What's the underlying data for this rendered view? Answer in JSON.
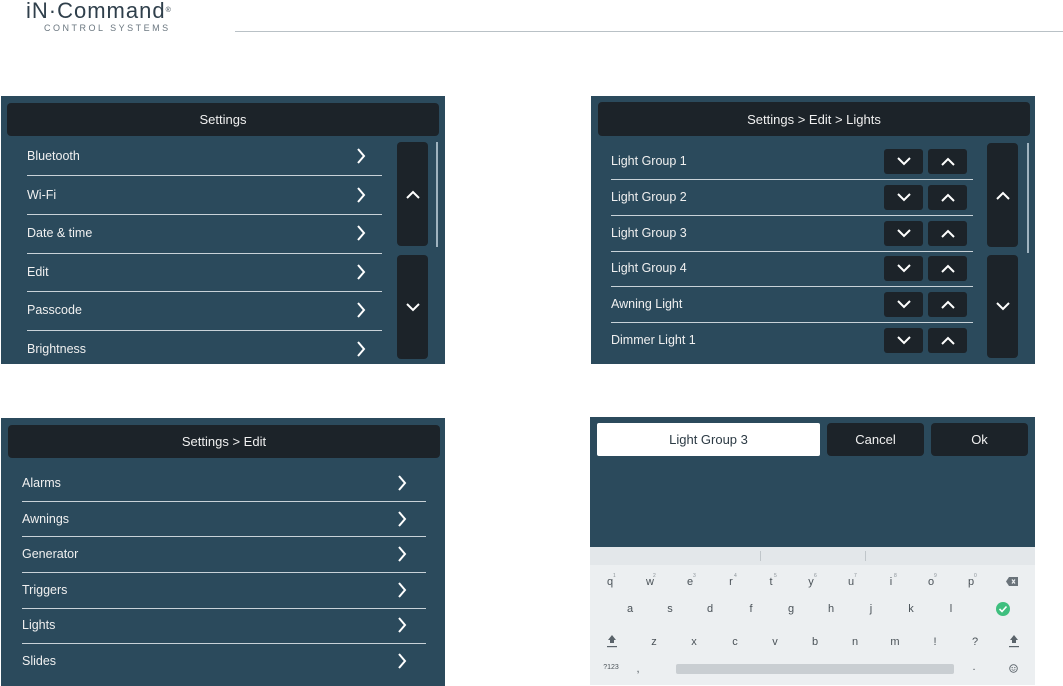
{
  "logo": {
    "brand": "iN·Command",
    "reg": "®",
    "tagline": "CONTROL SYSTEMS"
  },
  "settings_panel": {
    "title": "Settings",
    "items": [
      "Bluetooth",
      "Wi-Fi",
      "Date & time",
      "Edit",
      "Passcode",
      "Brightness"
    ]
  },
  "lights_panel": {
    "title": "Settings > Edit > Lights",
    "items": [
      "Light Group 1",
      "Light Group 2",
      "Light Group 3",
      "Light Group 4",
      "Awning Light",
      "Dimmer Light 1"
    ]
  },
  "edit_panel": {
    "title": "Settings > Edit",
    "items": [
      "Alarms",
      "Awnings",
      "Generator",
      "Triggers",
      "Lights",
      "Slides"
    ]
  },
  "keyboard_panel": {
    "input_value": "Light Group 3",
    "cancel_label": "Cancel",
    "ok_label": "Ok",
    "row1": [
      "q",
      "w",
      "e",
      "r",
      "t",
      "y",
      "u",
      "i",
      "o",
      "p"
    ],
    "row1_hints": [
      "1",
      "2",
      "3",
      "4",
      "5",
      "6",
      "7",
      "8",
      "9",
      "0"
    ],
    "row2": [
      "a",
      "s",
      "d",
      "f",
      "g",
      "h",
      "j",
      "k",
      "l"
    ],
    "row3": [
      "z",
      "x",
      "c",
      "v",
      "b",
      "n",
      "m",
      "!",
      "?"
    ],
    "symbols_key": "?123",
    "comma_key": ",",
    "period_key": "."
  },
  "colors": {
    "panel": "#2b4a5c",
    "title_bar": "#1c2329",
    "accent_green": "#3fbf7f"
  }
}
